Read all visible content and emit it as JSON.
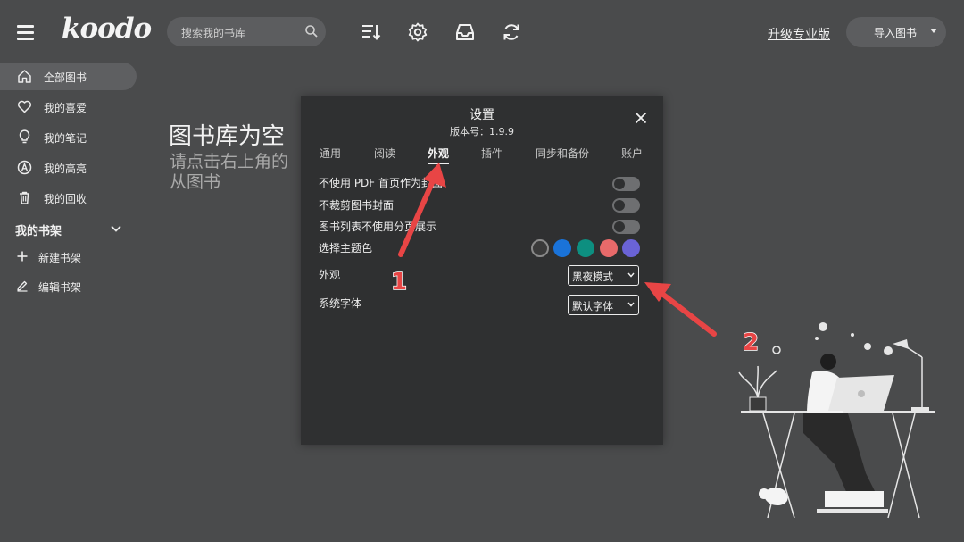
{
  "app": {
    "logo": "koodo"
  },
  "header": {
    "search_placeholder": "搜索我的书库",
    "upgrade_label": "升级专业版",
    "import_label": "导入图书",
    "tool_icons": [
      "sort-icon",
      "gear-icon",
      "inbox-icon",
      "sync-icon"
    ]
  },
  "sidebar": {
    "items": [
      {
        "label": "全部图书",
        "icon": "home-icon",
        "active": true
      },
      {
        "label": "我的喜爱",
        "icon": "heart-icon",
        "active": false
      },
      {
        "label": "我的笔记",
        "icon": "lightbulb-icon",
        "active": false
      },
      {
        "label": "我的高亮",
        "icon": "highlight-icon",
        "active": false
      },
      {
        "label": "我的回收",
        "icon": "trash-icon",
        "active": false
      }
    ],
    "shelf_heading": "我的书架",
    "shelf_items": [
      {
        "label": "新建书架",
        "icon": "plus-icon"
      },
      {
        "label": "编辑书架",
        "icon": "pencil-icon"
      }
    ]
  },
  "main": {
    "empty_title": "图书库为空",
    "empty_subtitle": "请点击右上角的从图书"
  },
  "settings": {
    "title": "设置",
    "version": "版本号：1.9.9",
    "tabs": [
      "通用",
      "阅读",
      "外观",
      "插件",
      "同步和备份",
      "账户"
    ],
    "active_tab": "外观",
    "toggles": [
      {
        "label": "不使用 PDF 首页作为封面",
        "on": false
      },
      {
        "label": "不裁剪图书封面",
        "on": false
      },
      {
        "label": "图书列表不使用分页展示",
        "on": false
      }
    ],
    "theme_label": "选择主题色",
    "theme_colors": [
      "#3a3a3a",
      "#1a73d9",
      "#0d8f80",
      "#e86a6a",
      "#6a63d6"
    ],
    "appearance_label": "外观",
    "appearance_value": "黑夜模式",
    "font_label": "系统字体",
    "font_value": "默认字体"
  },
  "annotations": {
    "marker_1": "1",
    "marker_2": "2",
    "arrow_color": "#e84545"
  }
}
